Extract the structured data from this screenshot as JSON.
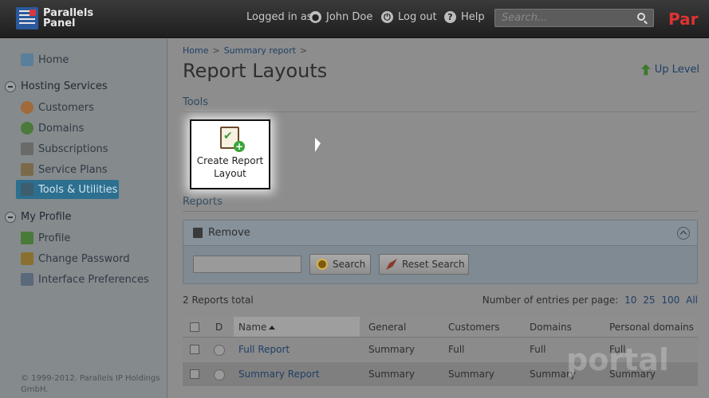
{
  "header": {
    "brand_line1": "Parallels",
    "brand_line2": "Panel",
    "logged_in_as": "Logged in as",
    "user_name": "John Doe",
    "logout": "Log out",
    "help": "Help",
    "search_placeholder": "Search...",
    "brand_right": "Par"
  },
  "sidebar": {
    "home": "Home",
    "hosting_services": "Hosting Services",
    "customers": "Customers",
    "domains": "Domains",
    "subscriptions": "Subscriptions",
    "service_plans": "Service Plans",
    "tools_utilities": "Tools & Utilities",
    "my_profile": "My Profile",
    "profile": "Profile",
    "change_password": "Change Password",
    "interface_preferences": "Interface Preferences",
    "copyright": "© 1999-2012. Parallels IP Holdings GmbH."
  },
  "main": {
    "breadcrumb_home": "Home",
    "breadcrumb_report": "Summary report",
    "breadcrumb_sep": ">",
    "title": "Report Layouts",
    "up_level": "Up Level",
    "tools_heading": "Tools",
    "create_report_layout": "Create Report Layout",
    "reports_heading": "Reports",
    "remove": "Remove",
    "search_button": "Search",
    "reset_search_button": "Reset Search",
    "total": "2 Reports total",
    "per_page_label": "Number of entries per page:",
    "per_page_options": [
      "10",
      "25",
      "100",
      "All"
    ]
  },
  "table": {
    "columns": [
      "D",
      "Name",
      "General",
      "Customers",
      "Domains",
      "Personal domains"
    ],
    "rows": [
      {
        "name": "Full Report",
        "general": "Summary",
        "customers": "Full",
        "domains": "Full",
        "personal": "Full"
      },
      {
        "name": "Summary Report",
        "general": "Summary",
        "customers": "Summary",
        "domains": "Summary",
        "personal": "Summary"
      }
    ]
  },
  "watermark": "portal"
}
